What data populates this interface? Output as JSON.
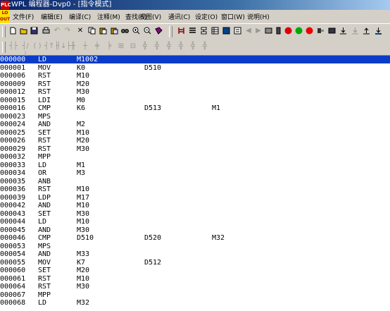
{
  "window": {
    "title": "WPL 编程器-Dvp0 - [指令模式]",
    "icon_text": "PLC"
  },
  "menu": {
    "mdi_icon_text": "LO OUT",
    "items": [
      "文件(F)",
      "编辑(E)",
      "编译(C)",
      "注释(M)",
      "查找(S)",
      "视图(V)",
      "通讯(C)",
      "设定(O)",
      "窗口(W)",
      "说明(H)"
    ]
  },
  "toolbar1": {
    "buttons": [
      "new-icon",
      "open-icon",
      "save-icon",
      "print-icon",
      "undo-icon",
      "redo-icon",
      "cut-icon",
      "copy-icon",
      "paste-icon",
      "paste-special-icon",
      "find-icon",
      "zoom-in-icon",
      "zoom-out-icon",
      "book-icon",
      "ladder-icon",
      "instruction-icon",
      "sfc-icon",
      "table-icon",
      "monitor-icon",
      "compile-icon",
      "arrow-icon",
      "red-circle-icon",
      "run-icon",
      "stop-icon",
      "device-icon",
      "upload-icon",
      "download-icon",
      "write-icon",
      "read-icon"
    ]
  },
  "toolbar2": {
    "buttons": [
      "contact-no-icon",
      "contact-nc-icon",
      "coil-icon",
      "rising-icon",
      "falling-icon",
      "invert-icon",
      "hline-icon",
      "vline-icon",
      "func-icon",
      "app-icon",
      "delete-icon",
      "seg1-icon",
      "seg2-icon",
      "seg3-icon",
      "seg4-icon"
    ]
  },
  "program": [
    {
      "step": "000000",
      "op": "LD",
      "a1": "M1002",
      "a2": "",
      "a3": "",
      "selected": true
    },
    {
      "step": "000001",
      "op": "MOV",
      "a1": "K0",
      "a2": "D510",
      "a3": ""
    },
    {
      "step": "000006",
      "op": "RST",
      "a1": "M10",
      "a2": "",
      "a3": ""
    },
    {
      "step": "000009",
      "op": "RST",
      "a1": "M20",
      "a2": "",
      "a3": ""
    },
    {
      "step": "000012",
      "op": "RST",
      "a1": "M30",
      "a2": "",
      "a3": ""
    },
    {
      "step": "000015",
      "op": "LDI",
      "a1": "M0",
      "a2": "",
      "a3": ""
    },
    {
      "step": "000016",
      "op": "CMP",
      "a1": "K6",
      "a2": "D513",
      "a3": "M1"
    },
    {
      "step": "000023",
      "op": "MPS",
      "a1": "",
      "a2": "",
      "a3": ""
    },
    {
      "step": "000024",
      "op": "AND",
      "a1": "M2",
      "a2": "",
      "a3": ""
    },
    {
      "step": "000025",
      "op": "SET",
      "a1": "M10",
      "a2": "",
      "a3": ""
    },
    {
      "step": "000026",
      "op": "RST",
      "a1": "M20",
      "a2": "",
      "a3": ""
    },
    {
      "step": "000029",
      "op": "RST",
      "a1": "M30",
      "a2": "",
      "a3": ""
    },
    {
      "step": "000032",
      "op": "MPP",
      "a1": "",
      "a2": "",
      "a3": ""
    },
    {
      "step": "000033",
      "op": "LD",
      "a1": "M1",
      "a2": "",
      "a3": ""
    },
    {
      "step": "000034",
      "op": "OR",
      "a1": "M3",
      "a2": "",
      "a3": ""
    },
    {
      "step": "000035",
      "op": "ANB",
      "a1": "",
      "a2": "",
      "a3": ""
    },
    {
      "step": "000036",
      "op": "RST",
      "a1": "M10",
      "a2": "",
      "a3": ""
    },
    {
      "step": "000039",
      "op": "LDP",
      "a1": "M17",
      "a2": "",
      "a3": ""
    },
    {
      "step": "000042",
      "op": "AND",
      "a1": "M10",
      "a2": "",
      "a3": ""
    },
    {
      "step": "000043",
      "op": "SET",
      "a1": "M30",
      "a2": "",
      "a3": ""
    },
    {
      "step": "000044",
      "op": "LD",
      "a1": "M10",
      "a2": "",
      "a3": ""
    },
    {
      "step": "000045",
      "op": "AND",
      "a1": "M30",
      "a2": "",
      "a3": ""
    },
    {
      "step": "000046",
      "op": "CMP",
      "a1": "D510",
      "a2": "D520",
      "a3": "M32"
    },
    {
      "step": "000053",
      "op": "MPS",
      "a1": "",
      "a2": "",
      "a3": ""
    },
    {
      "step": "000054",
      "op": "AND",
      "a1": "M33",
      "a2": "",
      "a3": ""
    },
    {
      "step": "000055",
      "op": "MOV",
      "a1": "K7",
      "a2": "D512",
      "a3": ""
    },
    {
      "step": "000060",
      "op": "SET",
      "a1": "M20",
      "a2": "",
      "a3": ""
    },
    {
      "step": "000061",
      "op": "RST",
      "a1": "M10",
      "a2": "",
      "a3": ""
    },
    {
      "step": "000064",
      "op": "RST",
      "a1": "M30",
      "a2": "",
      "a3": ""
    },
    {
      "step": "000067",
      "op": "MPP",
      "a1": "",
      "a2": "",
      "a3": ""
    },
    {
      "step": "000068",
      "op": "LD",
      "a1": "M32",
      "a2": "",
      "a3": ""
    }
  ]
}
